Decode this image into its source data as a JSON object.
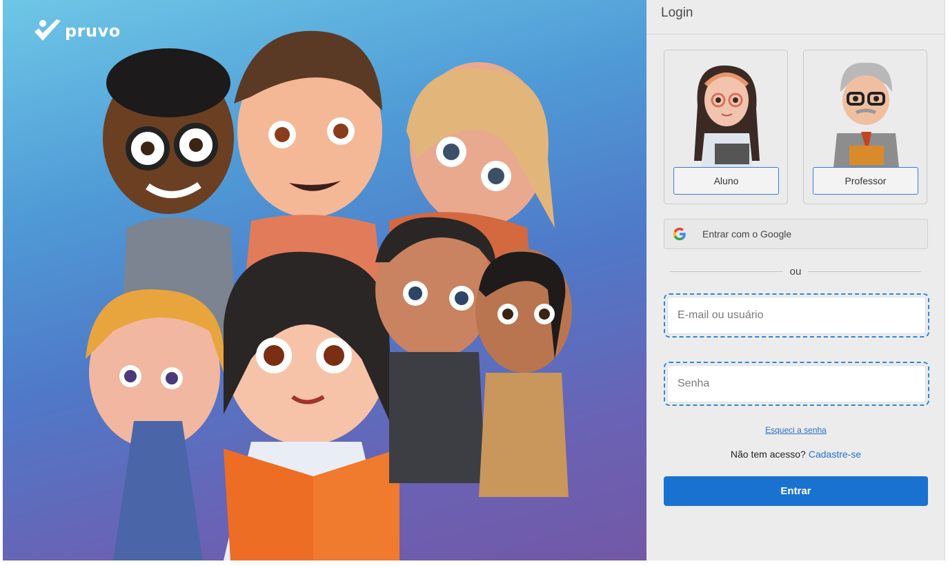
{
  "brand": {
    "name": "pruvo"
  },
  "login": {
    "title": "Login",
    "roles": [
      {
        "label": "Aluno",
        "icon": "student-avatar-icon"
      },
      {
        "label": "Professor",
        "icon": "teacher-avatar-icon"
      }
    ],
    "google_label": "Entrar com o Google",
    "or_label": "ou",
    "email_placeholder": "E-mail ou usuário",
    "password_placeholder": "Senha",
    "forgot_label": "Esqueci a senha",
    "no_access_label": "Não tem acesso?",
    "signup_label": "Cadastre-se",
    "submit_label": "Entrar"
  },
  "colors": {
    "accent": "#1a72d0",
    "link": "#2a6fc9",
    "focus_outline": "#2a86e0"
  }
}
